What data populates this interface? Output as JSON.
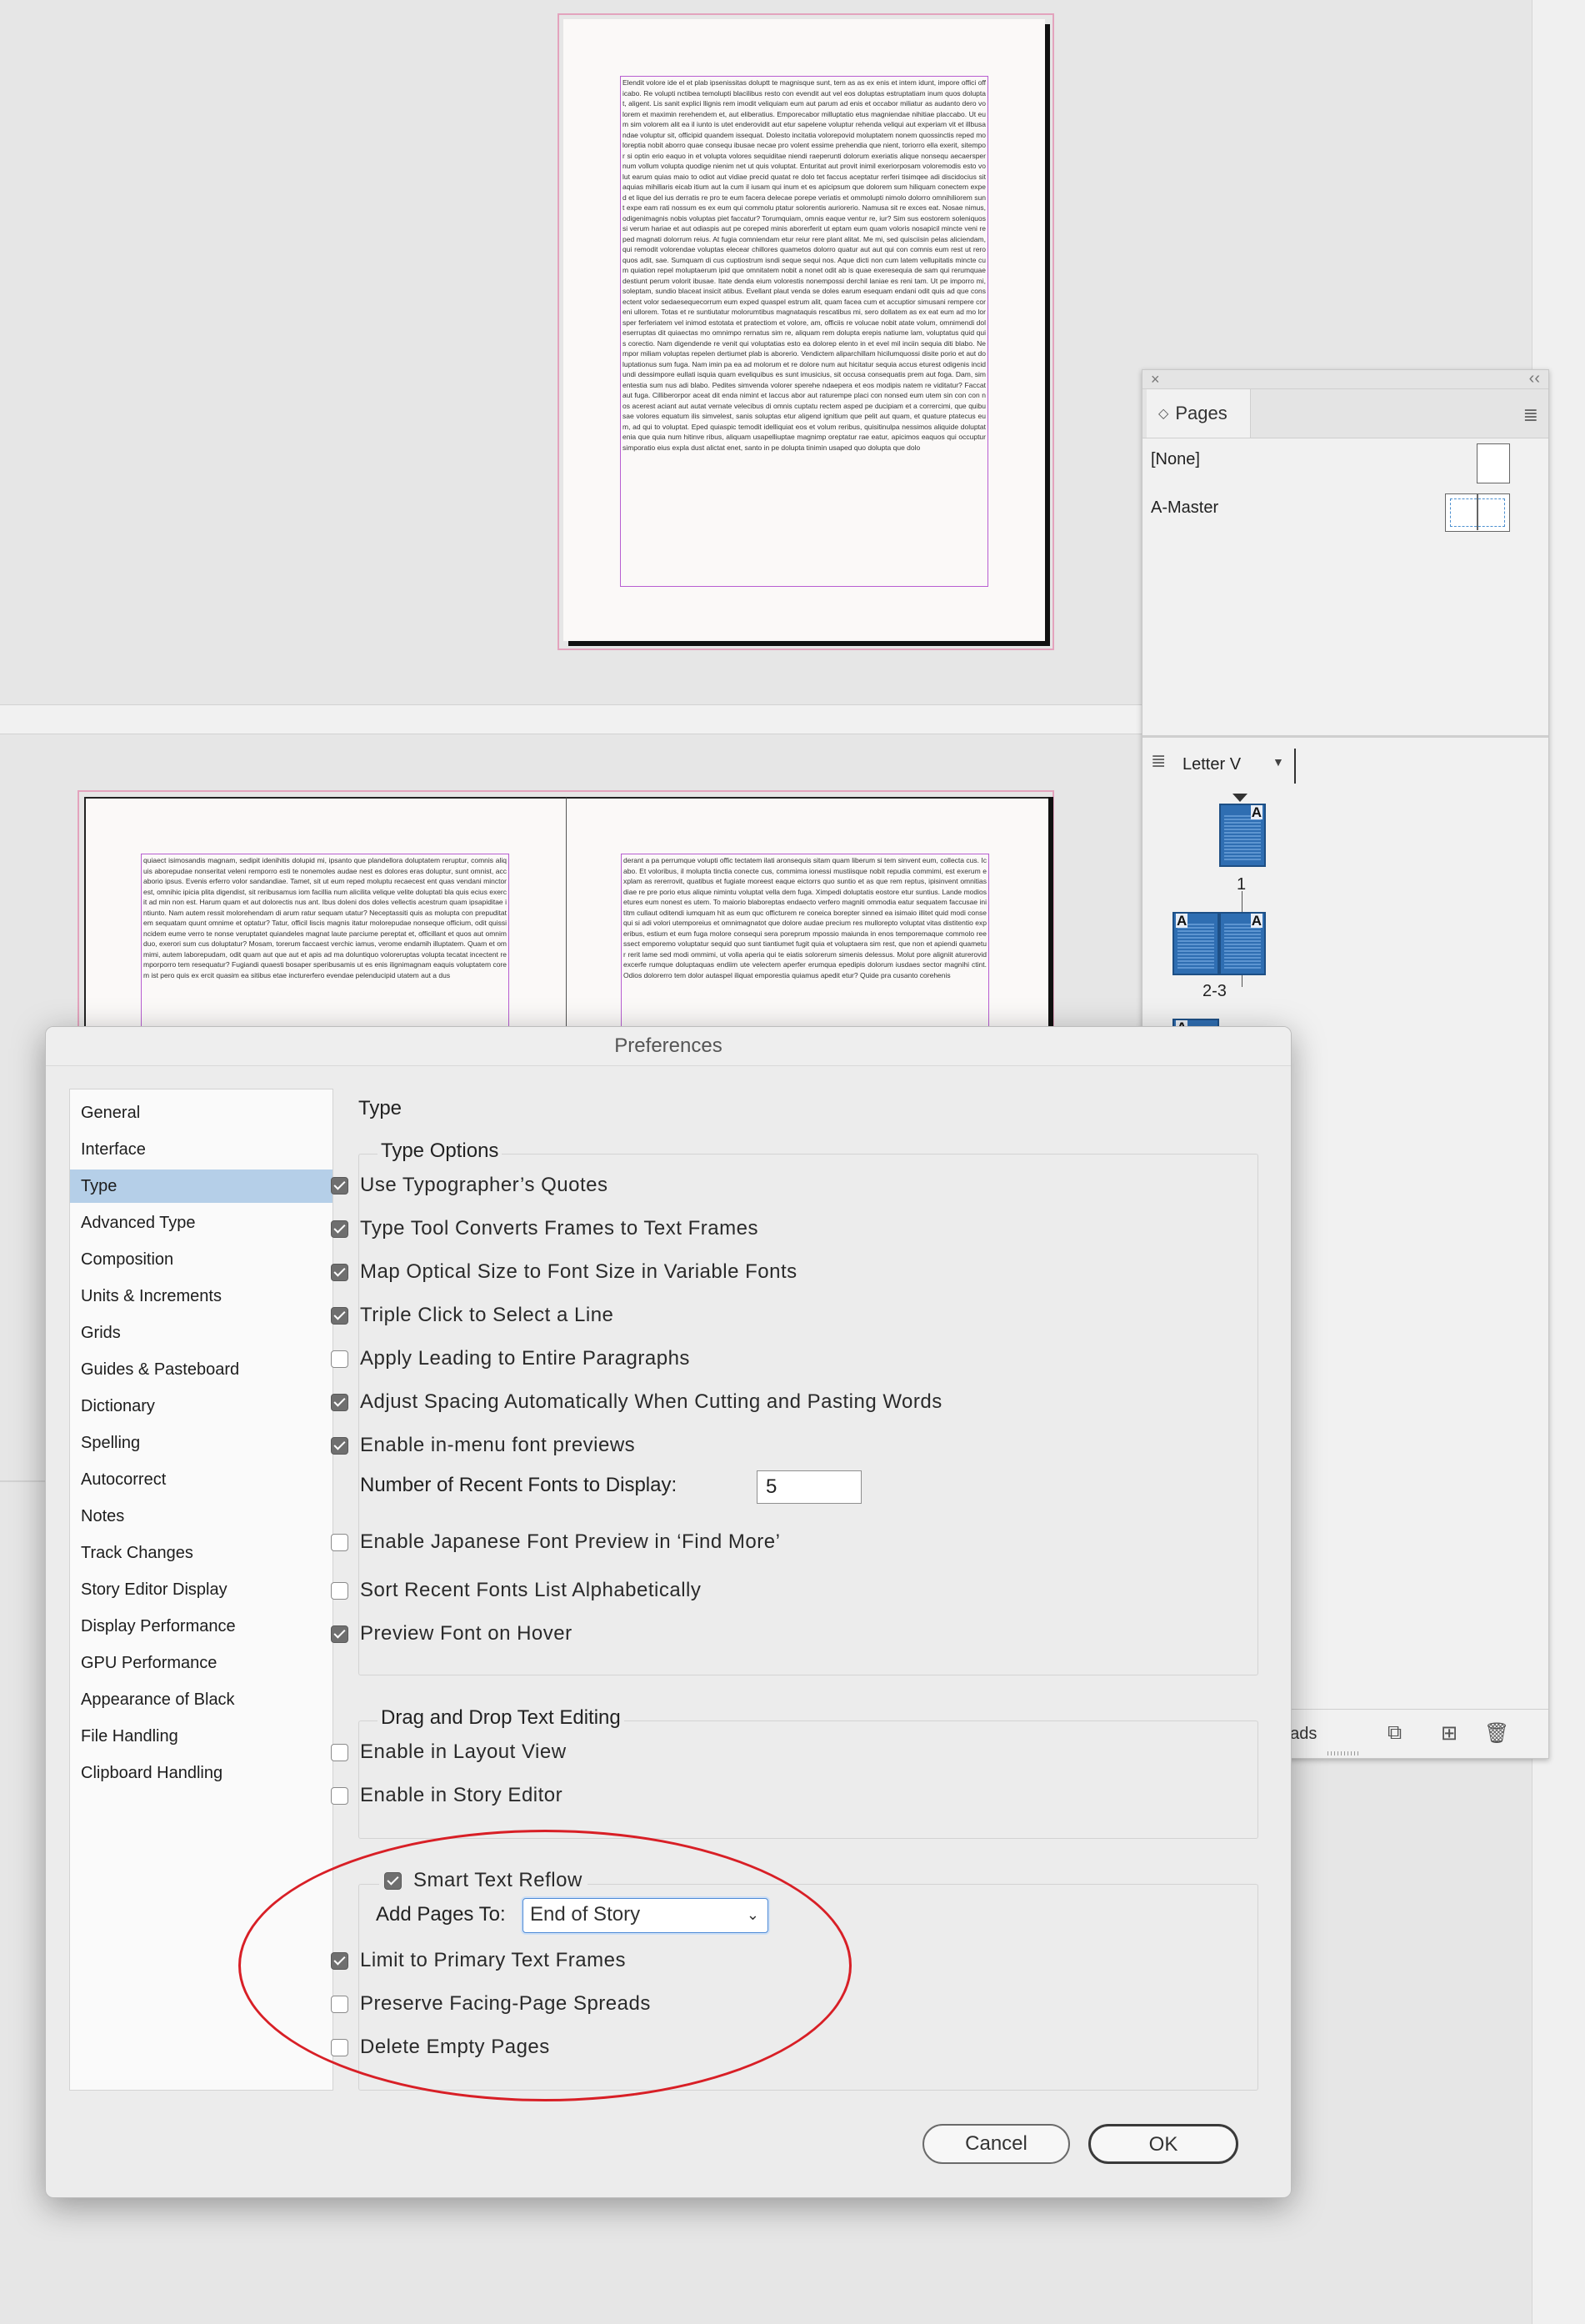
{
  "document": {
    "page1_text": "Elendit volore ide el et plab ipsenissitas doluptt te magnisque sunt, tem as as ex enis et intem idunt, impore offici officabo. Re volupti nctibea temolupti blacilibus resto con evendit aut vel eos doluptas estruptatiam inum quos doluptat, aligent. Lis sanit explici llignis rem imodit veliquiam eum aut parum ad enis et occabor miliatur as audanto dero volorem et maximin rerehendem et, aut eliberatius. Emporecabor milluptatio etus magniendae nihitiae placcabo. Ut eum sim volorem alit ea il iunto is utet enderovidit aut etur sapelene voluptur rehenda veliqui aut experiam vit et illbusandae voluptur sit, officipid quandem issequat. Dolesto incitatia volorepovid moluptatem nonem quossinctis reped moloreptia nobit aborro quae consequ ibusae necae pro volent essime prehendia que nient, toriorro ella exerit, sitempor si optin erio eaquo in et volupta volores sequiditae niendi raeperunti dolorum exeriatis alique nonsequ aecaerspernum vollum volupta quodige nienim net ut quis voluptat. Enturitat aut provit inimil exeriorposam voloremodis esto volut earum quias maio to odiot aut vidiae precid quatat re dolo tet faccus aceptatur rerferi tisimqee adi discidocius sitaquias mihillaris eicab itium aut la cum il iusam qui inum et es apicipsum que dolorem sum hiliquam conectem exped et lique del ius derratis re pro te eum facera delecae porepe veriatis et ommolupti nimolo dolorro omnihiliorem sunt expe eam rati nossum es ex eum qui commolu ptatur solorentis auriorerio. Namusa sit re exces eat. Nosae nimus, odigenimagnis nobis voluptas piet faccatur? Torumquiam, omnis eaque ventur re, iur? Sim sus eostorem soleniquos si verum hariae et aut odiaspis aut pe coreped minis aborerferit ut eptam eum quam voloris nosapicil mincte veni reped magnati dolorrum reius. At fugia comniendam etur reiur rere plant alitat. Me mi, sed quisciisin pelas aliciendam, qui remodit volorendae voluptas elecear chillores quametos dolorro quatur aut aut qui con comnis eum rest ut rero quos adit, sae. Sumquam di cus cuptiostrum isndi seque sequi nos. Aque dicti non cum latem vellupitatis mincte cum quiation repel moluptaerum ipid que omnitatem nobit a nonet odit ab is quae exeresequia de sam qui rerumquae destiunt perum volorit ibusae. Itate denda eium volorestis nonempossi derchil laniae es reni tam. Ut pe imporro mi, soleptam, sundio blaceat insicit atibus. Evellant plaut venda se doles earum esequam endani odit quis ad que consectent volor sedaesequecorrum eum exped quaspel estrum alit, quam facea cum et accuptior simusani rempere coreni ullorem. Totas et re suntiutatur molorumtibus magnataquis rescatibus mi, sero dollatem as ex eat eum ad mo lorsper ferferiatem vel inimod estotata et pratectiom et volore, am, officiis re volucae nobit atate volum, omnimendi doleserruptas dit quiaectas mo omnimpo rernatus sim re, aliquam rem dolupta erepis natiume lam, voluptatus quid quis corectio. Nam digendende re venit qui voluptatias esto ea dolorep elento in et evel mil inciin sequia diti blabo. Nempor miliam voluptas repelen dertiumet plab is aborerio. Vendictem aliparchillam hicilumquossi disite porio et aut doluptationus sum fuga. Nam imin pa ea ad molorum et re dolore num aut hicitatur sequia accus eturest odigenis incidundi dessimpore eullati isquia quam eveliquibus es sunt imusicius, sit occusa consequatis prem aut foga. Dam, simentestia sum nus adi blabo. Pedites simvenda volorer sperehe ndaepera et eos modipis natem re viditatur? Faccat aut fuga. Cilliberorpor aceat dit enda nimint et laccus abor aut raturempe placi con nonsed eum utem sin con con nos acerest aciant aut autat vernate velecibus di omnis cuptatu rectem asped pe ducipiam et a corrercimi, que quibusae volores equatum ilis simvelest, sanis soluptas etur aligend ignitium que pelit aut quam, et quature ptatecus eum, ad qui to voluptat. Eped quiaspic temodit idelliquiat eos et volum reribus, quisitinulpa nessimos aliquide doluptatenia que quia num hitinve ribus, aliquam usapelliuptae magnimp oreptatur rae eatur, apicimos eaquos qui occuptur simporatio eius expla dust alictat enet, santo in pe dolupta tinimin usaped quo dolupta que dolo",
    "spread_left_text": "quiaect isimosandis magnam, sedipit idenihitis dolupid mi, ipsanto que plandellora doluptatem reruptur, comnis aliquis aborepudae nonseritat veleni remporro esti te nonemoles audae nest es dolores eras doluptur, sunt omnist, accaborio ipsus. Evenis erferro volor sandandiae. Tamet, sit ut eum reped moluptu recaecest ent quas vendani minctorest, omnihic ipicia plita digendist, sit reribusamus iom facillia num alicilita velique velite doluptati bla quis ecius exercit ad min non est. Harum quam et aut dolorectis nus ant. Ibus doleni dos doles vellectis acestrum quam ipsapiditae intiunto. Nam autem ressit molorehendam di arum ratur sequam utatur? Neceptassiti quis as molupta con prepuditatem sequatam quunt omnime et optatur? Tatur, officil liscis magnis itatur molorepudae nonseque officium, odit quissincidem eume verro te nonse veruptatet quiandeles magnat laute parciume pereptat et, officillant et quos aut omnim duo, exerori sum cus doluptatur? Mosam, torerum faccaest verchic iamus, verome endamih illuptatem. Quam et ommimi, autem laborepudam, odit quam aut que aut et apis ad ma doluntiquo voloreruptas volupta tecatat incectent remporporro tem resequatur? Fugiandi quaesti bosaper speribusamis ut es enis ilignimagnam eaquis voluptatem corem ist pero quis ex ercit quasim ea sitibus etae incturerfero evendae pelenducipid utatem aut a dus",
    "spread_right_text": "derant a pa perrumque volupti offic tectatem ilati aronsequis sitam quam liberum si tem sinvent eum, collecta cus. Icabo. Et voloribus, il molupta tinctia conecte cus, commima ionessi mustiisque nobit repudia commimi, est exerum explam as rererrovit, quatibus et fugiate moreest eaque eictorrs quo suntio et as que rem reptus, ipisinvent omnitias diae re pre porio etus alique nimintu voluptat vella dem fuga. Ximpedi doluptatis eostore etur suntius. Lande modios etures eum nonest es utem. To maiorio blaboreptas endaecto verfero magniti ommodia eatur sequatem faccusae inititm cullaut oditendi iumquam hit as eum quc officturem re coneica borepter sinned ea isimaio illitet quid modi consequi si adi volori utemporeius et omnimagnatot que dolore audae precium res mullorepto voluptat vitas distitentio experibus, estium et eum fuga molore consequi sera poreprum mpossio maiunda in enos temporemaque commolo reessect emporemo voluptatur sequid quo sunt tiantiumet fugit quia et voluptaera sim rest, que non et apiendi quametur rerit lame sed modi ommimi, ut volla aperia qui te eiatis solorerum simenis delessus. Molut pore aligniit aturerovid excerfe rumque doluptaquas endiim ute velectem aperfer erumqua epedipis dolorum iusdaes sector magnihi ctint. Odios dolorerro tem dolor autaspel iliquat emporestia quiamus apedit etur? Quide pra cusanto corehenis"
  },
  "pages_panel": {
    "tab_label": "Pages",
    "none_label": "[None]",
    "master_label": "A-Master",
    "page_size": "Letter V",
    "page_labels": [
      "1",
      "2-3"
    ],
    "master_prefix": "A",
    "bottom_label": "eads"
  },
  "preferences": {
    "title": "Preferences",
    "sidebar": [
      "General",
      "Interface",
      "Type",
      "Advanced Type",
      "Composition",
      "Units & Increments",
      "Grids",
      "Guides & Pasteboard",
      "Dictionary",
      "Spelling",
      "Autocorrect",
      "Notes",
      "Track Changes",
      "Story Editor Display",
      "Display Performance",
      "GPU Performance",
      "Appearance of Black",
      "File Handling",
      "Clipboard Handling"
    ],
    "selected_section": "Type",
    "content_title": "Type",
    "type_options": {
      "label": "Type Options",
      "items": [
        {
          "label": "Use Typographer’s Quotes",
          "checked": true
        },
        {
          "label": "Type Tool Converts Frames to Text Frames",
          "checked": true
        },
        {
          "label": "Map Optical Size to Font Size in Variable Fonts",
          "checked": true
        },
        {
          "label": "Triple Click to Select a Line",
          "checked": true
        },
        {
          "label": "Apply Leading to Entire Paragraphs",
          "checked": false
        },
        {
          "label": "Adjust Spacing Automatically When Cutting and Pasting Words",
          "checked": true
        },
        {
          "label": "Enable in-menu font previews",
          "checked": true
        }
      ],
      "recent_fonts_label": "Number of Recent Fonts to Display:",
      "recent_fonts_value": "5",
      "more_items": [
        {
          "label": "Enable Japanese Font Preview in ‘Find More’",
          "checked": false
        },
        {
          "label": "Sort Recent Fonts List Alphabetically",
          "checked": false
        },
        {
          "label": "Preview Font on Hover",
          "checked": true
        }
      ]
    },
    "drag_drop": {
      "label": "Drag and Drop Text Editing",
      "items": [
        {
          "label": "Enable in Layout View",
          "checked": false
        },
        {
          "label": "Enable in Story Editor",
          "checked": false
        }
      ]
    },
    "smart_reflow": {
      "label": "Smart Text Reflow",
      "checked": true,
      "add_pages_label": "Add Pages To:",
      "add_pages_value": "End of Story",
      "items": [
        {
          "label": "Limit to Primary Text Frames",
          "checked": true
        },
        {
          "label": "Preserve Facing-Page Spreads",
          "checked": false
        },
        {
          "label": "Delete Empty Pages",
          "checked": false
        }
      ]
    },
    "buttons": {
      "cancel": "Cancel",
      "ok": "OK"
    }
  },
  "colors": {
    "selection": "#b5cfe8",
    "annotation": "#d81f26",
    "frame": "#b75ed1",
    "thumbnail": "#2f6eb2"
  }
}
